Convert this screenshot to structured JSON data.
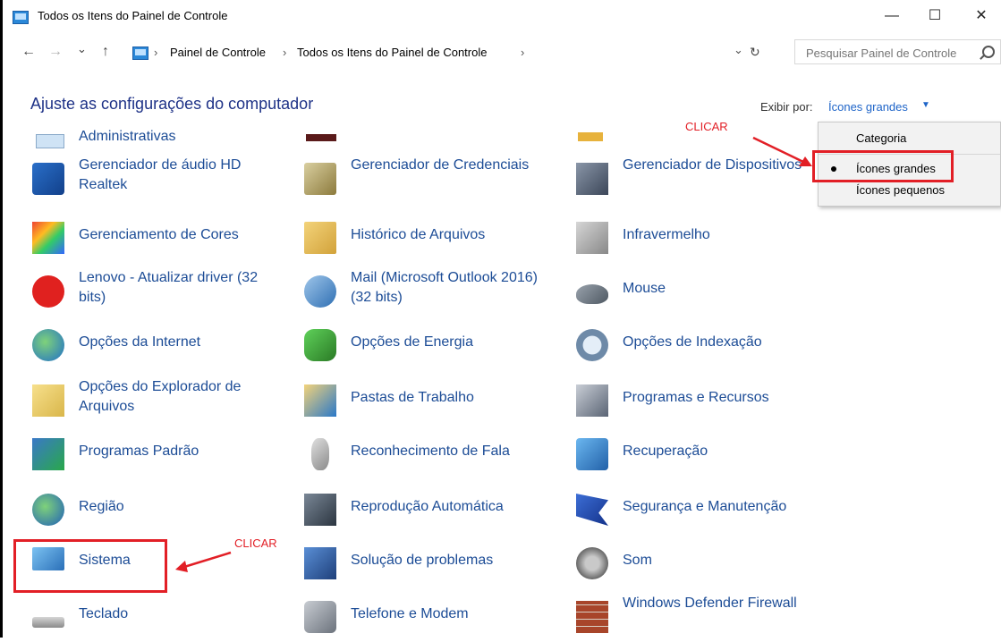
{
  "window": {
    "title": "Todos os Itens do Painel de Controle",
    "minimize": "—",
    "maximize": "☐",
    "close": "✕"
  },
  "nav": {
    "back": "←",
    "forward": "→",
    "recent": "⌄",
    "up": "↑",
    "breadcrumbs": [
      "Painel de Controle",
      "Todos os Itens do Painel de Controle"
    ],
    "separator": "›",
    "dropdown": "⌄",
    "refresh": "↻",
    "search_placeholder": "Pesquisar Painel de Controle"
  },
  "page": {
    "heading": "Ajuste as configurações do computador",
    "viewby_label": "Exibir por:",
    "viewby_value": "Ícones grandes",
    "caret": "▼"
  },
  "menu": {
    "items": [
      {
        "label": "Categoria",
        "selected": false
      },
      {
        "label": "Ícones grandes",
        "selected": true
      },
      {
        "label": "Ícones pequenos",
        "selected": false
      }
    ]
  },
  "annotations": {
    "top": "CLICAR",
    "bottom": "CLICAR",
    "color": "#e21f26"
  },
  "partial_item": {
    "label": "Administrativas"
  },
  "items": [
    {
      "label": "Gerenciador de áudio HD Realtek",
      "icon": "audio-icon"
    },
    {
      "label": "Gerenciador de Credenciais",
      "icon": "credentials-safe-icon"
    },
    {
      "label": "Gerenciador de Dispositivos",
      "icon": "device-manager-icon"
    },
    {
      "label": "Gerenciamento de Cores",
      "icon": "color-management-icon"
    },
    {
      "label": "Histórico de Arquivos",
      "icon": "file-history-icon"
    },
    {
      "label": "Infravermelho",
      "icon": "infrared-icon"
    },
    {
      "label": "Lenovo - Atualizar driver (32 bits)",
      "icon": "lenovo-update-icon"
    },
    {
      "label": "Mail (Microsoft Outlook 2016) (32 bits)",
      "icon": "mail-icon"
    },
    {
      "label": "Mouse",
      "icon": "mouse-icon"
    },
    {
      "label": "Opções da Internet",
      "icon": "internet-options-icon"
    },
    {
      "label": "Opções de Energia",
      "icon": "power-options-icon"
    },
    {
      "label": "Opções de Indexação",
      "icon": "indexing-icon"
    },
    {
      "label": "Opções do Explorador de Arquivos",
      "icon": "folder-options-icon"
    },
    {
      "label": "Pastas de Trabalho",
      "icon": "work-folders-icon"
    },
    {
      "label": "Programas e Recursos",
      "icon": "programs-features-icon"
    },
    {
      "label": "Programas Padrão",
      "icon": "default-programs-icon"
    },
    {
      "label": "Reconhecimento de Fala",
      "icon": "microphone-icon"
    },
    {
      "label": "Recuperação",
      "icon": "recovery-icon"
    },
    {
      "label": "Região",
      "icon": "region-globe-icon"
    },
    {
      "label": "Reprodução Automática",
      "icon": "autoplay-icon"
    },
    {
      "label": "Segurança e Manutenção",
      "icon": "security-flag-icon"
    },
    {
      "label": "Sistema",
      "icon": "system-monitor-icon"
    },
    {
      "label": "Solução de problemas",
      "icon": "troubleshooting-icon"
    },
    {
      "label": "Som",
      "icon": "speaker-icon"
    },
    {
      "label": "Teclado",
      "icon": "keyboard-icon"
    },
    {
      "label": "Telefone e Modem",
      "icon": "phone-modem-icon"
    },
    {
      "label": "Windows Defender Firewall",
      "icon": "firewall-icon"
    }
  ]
}
